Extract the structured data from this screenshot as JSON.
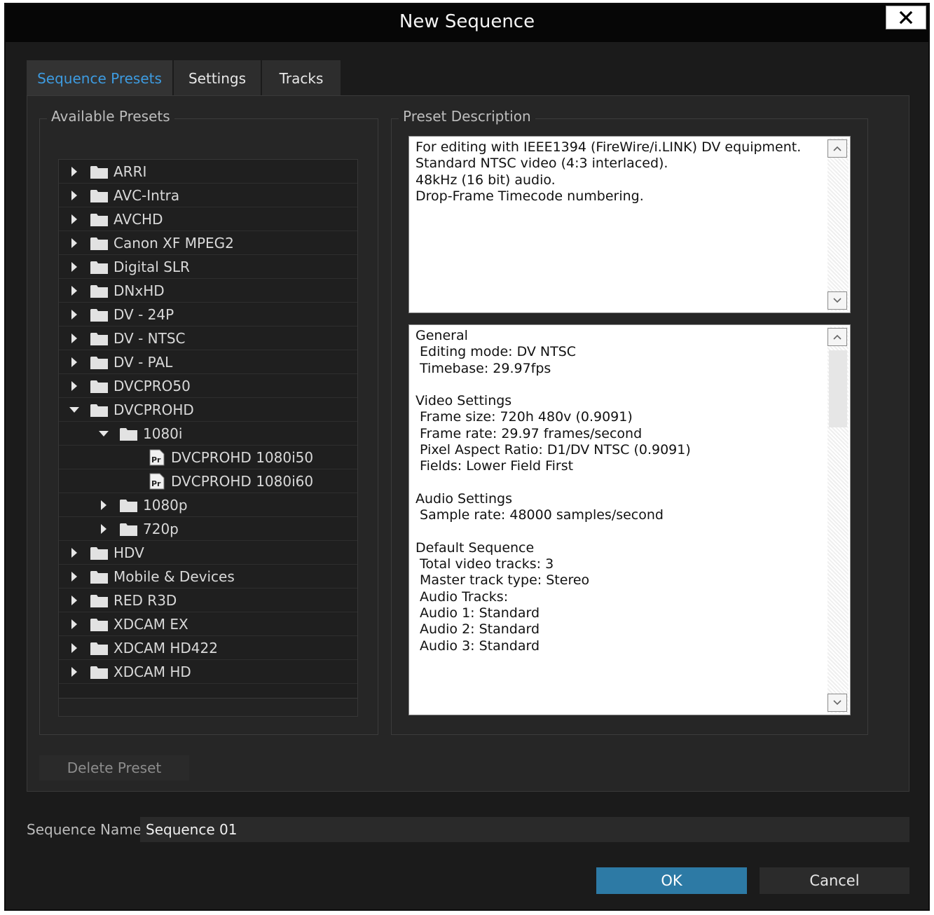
{
  "window": {
    "title": "New Sequence"
  },
  "tabs": [
    {
      "label": "Sequence Presets",
      "active": true
    },
    {
      "label": "Settings",
      "active": false
    },
    {
      "label": "Tracks",
      "active": false
    }
  ],
  "presets": {
    "group_label": "Available Presets",
    "items": [
      {
        "label": "ARRI",
        "level": 0,
        "type": "folder",
        "expanded": false
      },
      {
        "label": "AVC-Intra",
        "level": 0,
        "type": "folder",
        "expanded": false
      },
      {
        "label": "AVCHD",
        "level": 0,
        "type": "folder",
        "expanded": false
      },
      {
        "label": "Canon XF MPEG2",
        "level": 0,
        "type": "folder",
        "expanded": false
      },
      {
        "label": "Digital SLR",
        "level": 0,
        "type": "folder",
        "expanded": false
      },
      {
        "label": "DNxHD",
        "level": 0,
        "type": "folder",
        "expanded": false
      },
      {
        "label": "DV - 24P",
        "level": 0,
        "type": "folder",
        "expanded": false
      },
      {
        "label": "DV - NTSC",
        "level": 0,
        "type": "folder",
        "expanded": false
      },
      {
        "label": "DV - PAL",
        "level": 0,
        "type": "folder",
        "expanded": false
      },
      {
        "label": "DVCPRO50",
        "level": 0,
        "type": "folder",
        "expanded": false
      },
      {
        "label": "DVCPROHD",
        "level": 0,
        "type": "folder",
        "expanded": true
      },
      {
        "label": "1080i",
        "level": 1,
        "type": "folder",
        "expanded": true
      },
      {
        "label": "DVCPROHD 1080i50",
        "level": 2,
        "type": "preset",
        "icon_text": "Pr"
      },
      {
        "label": "DVCPROHD 1080i60",
        "level": 2,
        "type": "preset",
        "icon_text": "Pr"
      },
      {
        "label": "1080p",
        "level": 1,
        "type": "folder",
        "expanded": false
      },
      {
        "label": "720p",
        "level": 1,
        "type": "folder",
        "expanded": false
      },
      {
        "label": "HDV",
        "level": 0,
        "type": "folder",
        "expanded": false
      },
      {
        "label": "Mobile & Devices",
        "level": 0,
        "type": "folder",
        "expanded": false
      },
      {
        "label": "RED R3D",
        "level": 0,
        "type": "folder",
        "expanded": false
      },
      {
        "label": "XDCAM EX",
        "level": 0,
        "type": "folder",
        "expanded": false
      },
      {
        "label": "XDCAM HD422",
        "level": 0,
        "type": "folder",
        "expanded": false
      },
      {
        "label": "XDCAM HD",
        "level": 0,
        "type": "folder",
        "expanded": false
      }
    ]
  },
  "description": {
    "group_label": "Preset Description",
    "summary": "For editing with IEEE1394 (FireWire/i.LINK) DV equipment.\nStandard NTSC video (4:3 interlaced).\n48kHz (16 bit) audio.\nDrop-Frame Timecode numbering.",
    "details": "General\n Editing mode: DV NTSC\n Timebase: 29.97fps\n\nVideo Settings\n Frame size: 720h 480v (0.9091)\n Frame rate: 29.97 frames/second\n Pixel Aspect Ratio: D1/DV NTSC (0.9091)\n Fields: Lower Field First\n\nAudio Settings\n Sample rate: 48000 samples/second\n\nDefault Sequence\n Total video tracks: 3\n Master track type: Stereo\n Audio Tracks:\n Audio 1: Standard\n Audio 2: Standard\n Audio 3: Standard"
  },
  "buttons": {
    "delete_preset": "Delete Preset",
    "ok": "OK",
    "cancel": "Cancel"
  },
  "sequence_name": {
    "label": "Sequence Name:",
    "value": "Sequence 01"
  },
  "colors": {
    "accent": "#3d9be0",
    "ok_button": "#2d7aa5",
    "background": "#1b1b1b"
  }
}
